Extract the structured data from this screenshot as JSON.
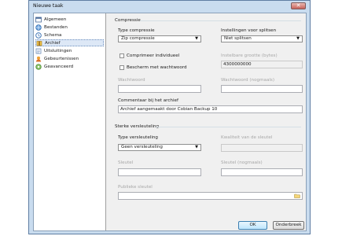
{
  "window": {
    "title": "Nieuwe taak",
    "close_glyph": "✕"
  },
  "sidebar": {
    "items": [
      {
        "label": "Algemeen",
        "icon": "general-icon",
        "selected": false
      },
      {
        "label": "Bestanden",
        "icon": "files-icon",
        "selected": false
      },
      {
        "label": "Schema",
        "icon": "schedule-icon",
        "selected": false
      },
      {
        "label": "Archief",
        "icon": "archive-icon",
        "selected": true
      },
      {
        "label": "Uitsluitingen",
        "icon": "exclusions-icon",
        "selected": false
      },
      {
        "label": "Gebeurtenissen",
        "icon": "events-icon",
        "selected": false
      },
      {
        "label": "Geavanceerd",
        "icon": "advanced-icon",
        "selected": false
      }
    ]
  },
  "compression": {
    "section_title": "Compressie",
    "type_label": "Type compressie",
    "type_value": "Zip compressie",
    "split_label": "Instellingen voor splitsen",
    "split_value": "Niet splitsen",
    "individual_label": "Comprimeer individueel",
    "password_protect_label": "Bescherm met wachtwoord",
    "split_size_label": "Instelbare grootte (bytes)",
    "split_size_value": "4300000000",
    "password_label": "Wachtwoord",
    "password_repeat_label": "Wachtwoord (nogmaals)",
    "comment_label": "Commentaar bij het archief",
    "comment_value": "Archief aangemaakt door Cobian Backup 10"
  },
  "encryption": {
    "section_title": "Sterke versleuteling",
    "type_label": "Type versleuteling",
    "type_value": "Geen versleuteling",
    "key_quality_label": "Kwaliteit van de sleutel",
    "key_label": "Sleutel",
    "key_repeat_label": "Sleutel (nogmaals)",
    "public_key_label": "Publieke sleutel"
  },
  "buttons": {
    "ok": "OK",
    "cancel": "Onderbreek"
  },
  "colors": {
    "accent": "#3c7fb1",
    "selection": "#dde8f6",
    "frame": "#c9dcef"
  }
}
